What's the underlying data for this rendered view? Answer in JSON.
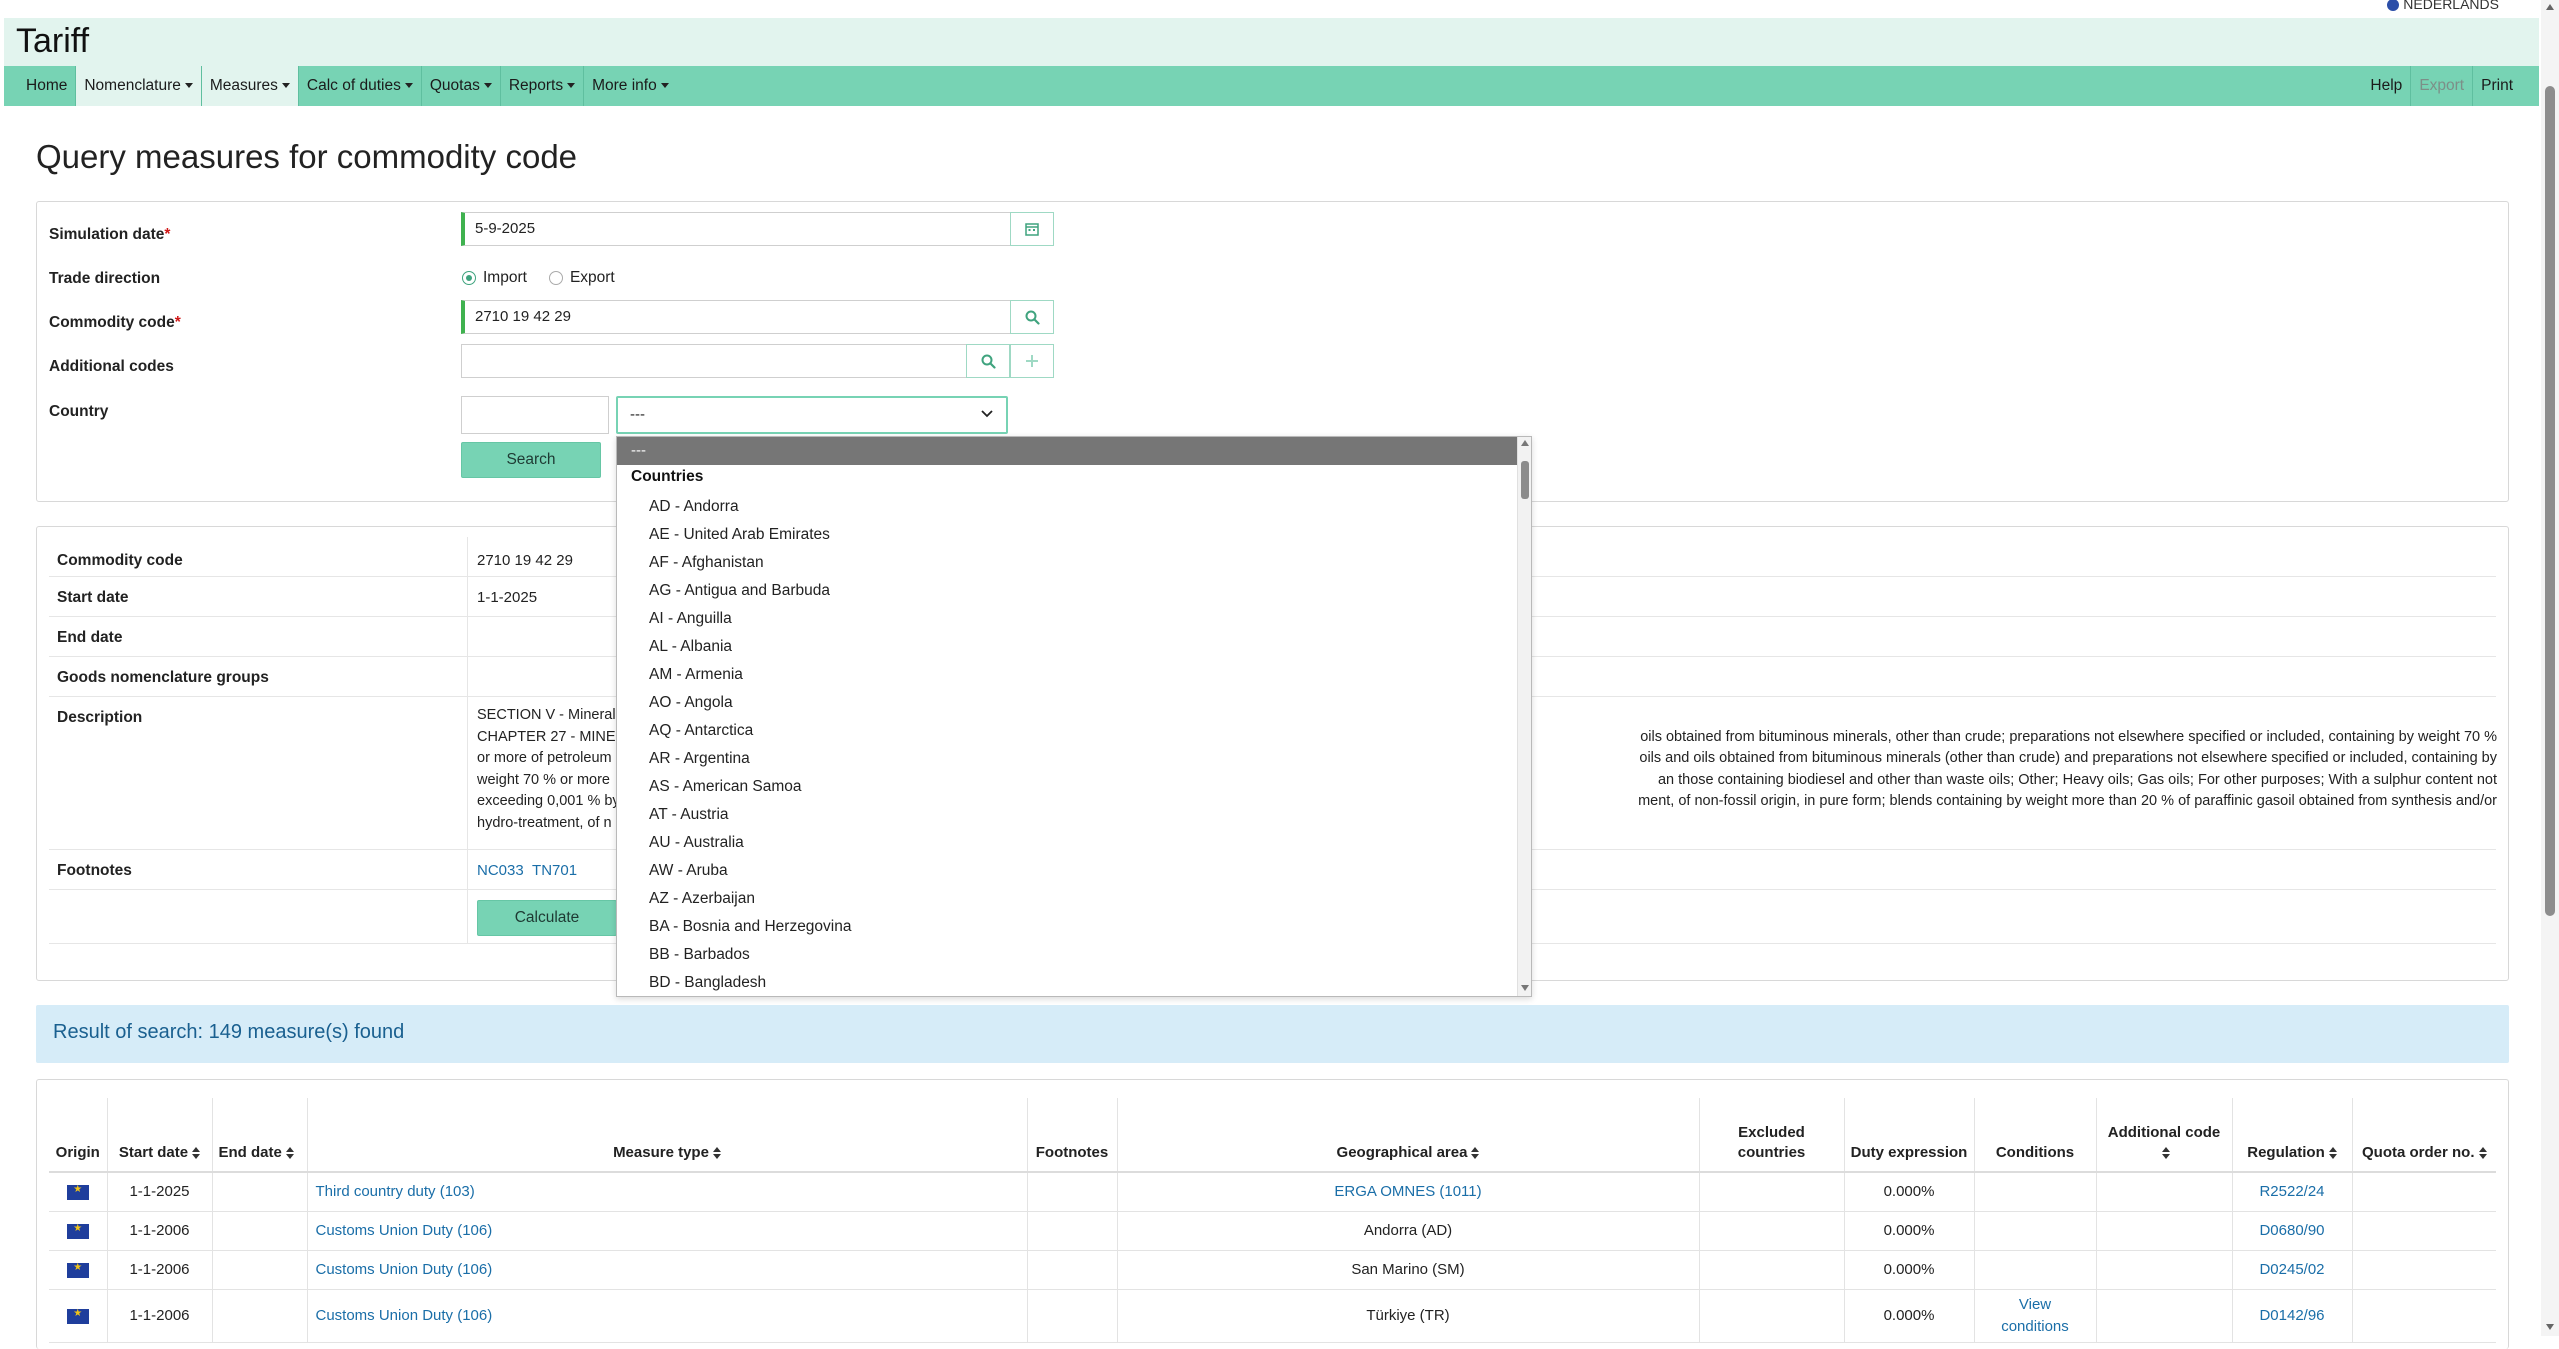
{
  "header": {
    "title": "Tariff",
    "language": "NEDERLANDS"
  },
  "nav": {
    "left": [
      {
        "label": "Home",
        "dropdown": false,
        "active": false
      },
      {
        "label": "Nomenclature",
        "dropdown": true,
        "active": true
      },
      {
        "label": "Measures",
        "dropdown": true,
        "active": true
      },
      {
        "label": "Calc of duties",
        "dropdown": true,
        "active": false
      },
      {
        "label": "Quotas",
        "dropdown": true,
        "active": false
      },
      {
        "label": "Reports",
        "dropdown": true,
        "active": false
      },
      {
        "label": "More info",
        "dropdown": true,
        "active": false
      }
    ],
    "right": {
      "help": "Help",
      "export": "Export",
      "print": "Print"
    }
  },
  "page": {
    "title": "Query measures for commodity code"
  },
  "form": {
    "simulation_date_label": "Simulation date",
    "simulation_date_value": "5-9-2025",
    "trade_direction_label": "Trade direction",
    "import_label": "Import",
    "export_label": "Export",
    "trade_direction_selected": "Import",
    "commodity_code_label": "Commodity code",
    "commodity_code_value": "2710 19 42 29",
    "additional_codes_label": "Additional codes",
    "additional_codes_value": "",
    "country_label": "Country",
    "country_code_value": "",
    "country_select_value": "---",
    "required_mark": "*",
    "search_button": "Search"
  },
  "country_dropdown": {
    "selected": "---",
    "group_label": "Countries",
    "options": [
      "AD - Andorra",
      "AE - United Arab Emirates",
      "AF - Afghanistan",
      "AG - Antigua and Barbuda",
      "AI - Anguilla",
      "AL - Albania",
      "AM - Armenia",
      "AO - Angola",
      "AQ - Antarctica",
      "AR - Argentina",
      "AS - American Samoa",
      "AT - Austria",
      "AU - Australia",
      "AW - Aruba",
      "AZ - Azerbaijan",
      "BA - Bosnia and Herzegovina",
      "BB - Barbados",
      "BD - Bangladesh"
    ]
  },
  "info": {
    "commodity_code_label": "Commodity code",
    "commodity_code_value": "2710 19 42 29",
    "start_date_label": "Start date",
    "start_date_value": "1-1-2025",
    "end_date_label": "End date",
    "end_date_value": "",
    "goods_groups_label": "Goods nomenclature groups",
    "goods_groups_value": "",
    "description_label": "Description",
    "description_lines": [
      {
        "left": "SECTION V - Mineral p",
        "right": ""
      },
      {
        "left": "CHAPTER 27 - MINERA",
        "right": "oils obtained from bituminous minerals, other than crude; preparations not elsewhere specified or included, containing by weight 70 %"
      },
      {
        "left": "or more of petroleum",
        "right": "oils and oils obtained from bituminous minerals (other than crude) and preparations not elsewhere specified or included, containing by"
      },
      {
        "left": "weight 70 % or more",
        "right": "an those containing biodiesel and other than waste oils; Other; Heavy oils; Gas oils; For other purposes; With a sulphur content not"
      },
      {
        "left": "exceeding 0,001 % by",
        "right": "ment, of non-fossil origin, in pure form; blends containing by weight more than 20 % of paraffinic gasoil obtained from synthesis and/or"
      },
      {
        "left": "hydro-treatment, of n",
        "right": ""
      }
    ],
    "footnotes_label": "Footnotes",
    "footnotes": [
      "NC033",
      "TN701"
    ],
    "calculate_button": "Calculate"
  },
  "result": {
    "summary": "Result of search: 149 measure(s) found"
  },
  "table": {
    "headers": {
      "origin": "Origin",
      "start_date": "Start date",
      "end_date": "End date",
      "measure_type": "Measure type",
      "footnotes": "Footnotes",
      "geo_area": "Geographical area",
      "excluded": "Excluded countries",
      "duty": "Duty expression",
      "conditions": "Conditions",
      "additional_code": "Additional code",
      "regulation": "Regulation",
      "quota": "Quota order no."
    },
    "rows": [
      {
        "start": "1-1-2025",
        "end": "",
        "measure": "Third country duty (103)",
        "footnotes": "",
        "geo": "ERGA OMNES (1011)",
        "geo_link": true,
        "excluded": "",
        "duty": "0.000%",
        "conditions": "",
        "additional": "",
        "regulation": "R2522/24",
        "quota": ""
      },
      {
        "start": "1-1-2006",
        "end": "",
        "measure": "Customs Union Duty (106)",
        "footnotes": "",
        "geo": "Andorra (AD)",
        "geo_link": false,
        "excluded": "",
        "duty": "0.000%",
        "conditions": "",
        "additional": "",
        "regulation": "D0680/90",
        "quota": ""
      },
      {
        "start": "1-1-2006",
        "end": "",
        "measure": "Customs Union Duty (106)",
        "footnotes": "",
        "geo": "San Marino (SM)",
        "geo_link": false,
        "excluded": "",
        "duty": "0.000%",
        "conditions": "",
        "additional": "",
        "regulation": "D0245/02",
        "quota": ""
      },
      {
        "start": "1-1-2006",
        "end": "",
        "measure": "Customs Union Duty (106)",
        "footnotes": "",
        "geo": "Türkiye (TR)",
        "geo_link": false,
        "excluded": "",
        "duty": "0.000%",
        "conditions": "View conditions",
        "additional": "",
        "regulation": "D0142/96",
        "quota": ""
      }
    ]
  },
  "colors": {
    "nav": "#77d3b4",
    "header_bg": "#e2f4ee",
    "link": "#1a6ea8",
    "valid_border": "#3fb24f",
    "required": "#d01818",
    "result_banner": "#d6ecf8"
  },
  "icons": {
    "calendar": "calendar-icon",
    "search": "search-icon",
    "plus": "plus-icon",
    "chevron": "chevron-down-icon",
    "flag": "eu-flag-icon",
    "sort": "sort-icon",
    "language": "language-flag-icon"
  }
}
